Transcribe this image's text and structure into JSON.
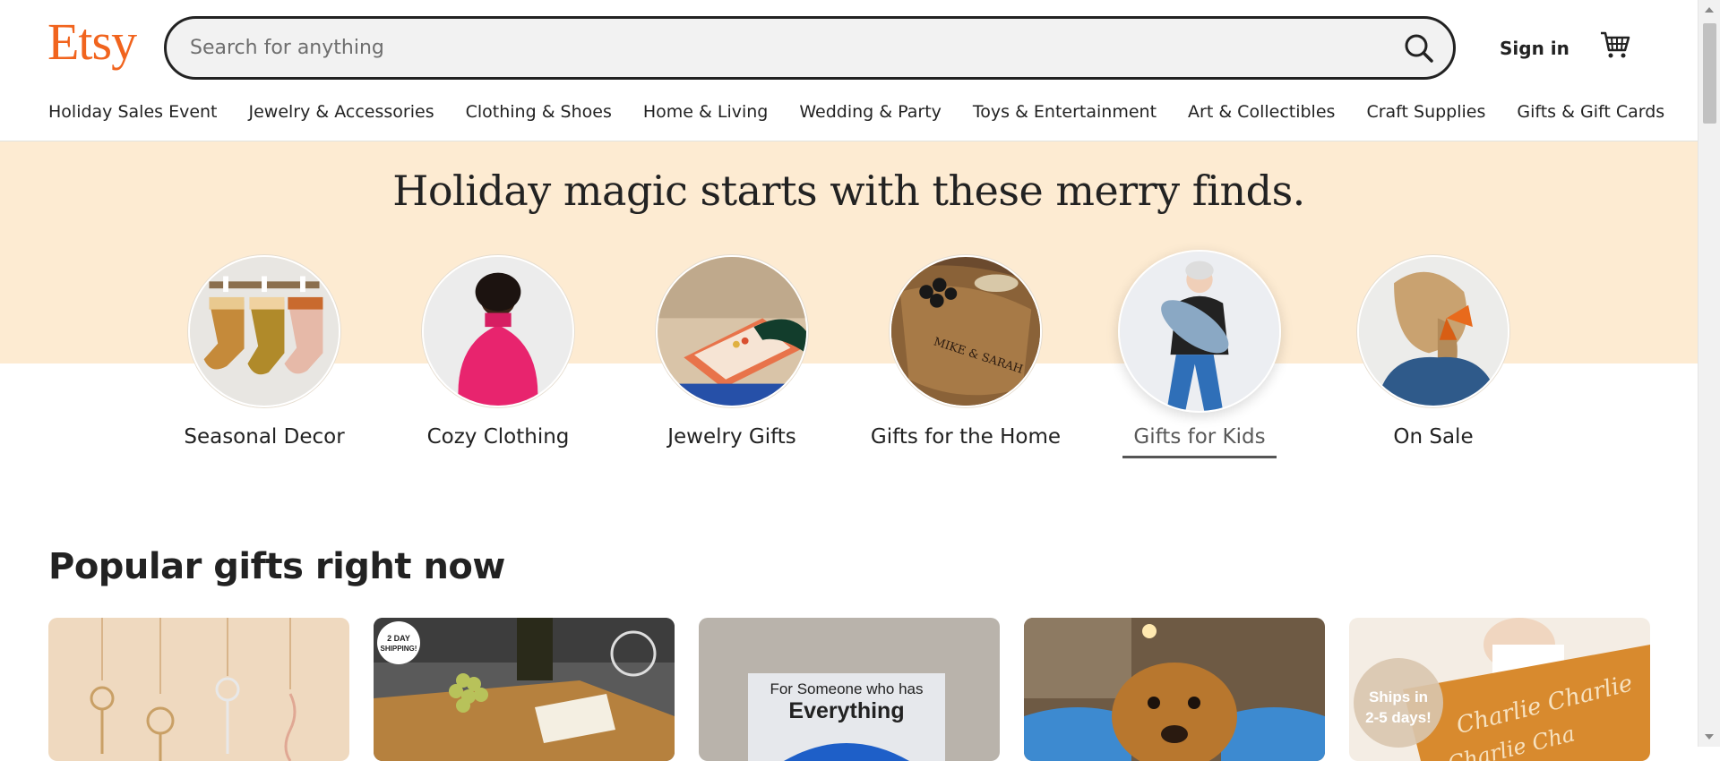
{
  "header": {
    "logo": "Etsy",
    "search_placeholder": "Search for anything",
    "signin_label": "Sign in",
    "cart_icon": "cart-icon",
    "search_icon": "search-icon"
  },
  "nav": {
    "items": [
      "Holiday Sales Event",
      "Jewelry & Accessories",
      "Clothing & Shoes",
      "Home & Living",
      "Wedding & Party",
      "Toys & Entertainment",
      "Art & Collectibles",
      "Craft Supplies",
      "Gifts & Gift Cards"
    ]
  },
  "hero": {
    "title": "Holiday magic starts with these merry finds.",
    "categories": [
      {
        "label": "Seasonal Decor"
      },
      {
        "label": "Cozy Clothing"
      },
      {
        "label": "Jewelry Gifts"
      },
      {
        "label": "Gifts for the Home"
      },
      {
        "label": "Gifts for Kids",
        "active": true
      },
      {
        "label": "On Sale"
      }
    ]
  },
  "popular": {
    "title": "Popular gifts right now",
    "cards": [
      {
        "badge": ""
      },
      {
        "badge": "2 DAY SHIPPING!"
      },
      {
        "text_top": "For Someone who has",
        "text_bottom": "Everything"
      },
      {
        "badge": ""
      },
      {
        "badge": "Ships in 2-5 days!"
      }
    ]
  },
  "colors": {
    "brand": "#f1641e",
    "hero_band": "#fdebd2"
  }
}
